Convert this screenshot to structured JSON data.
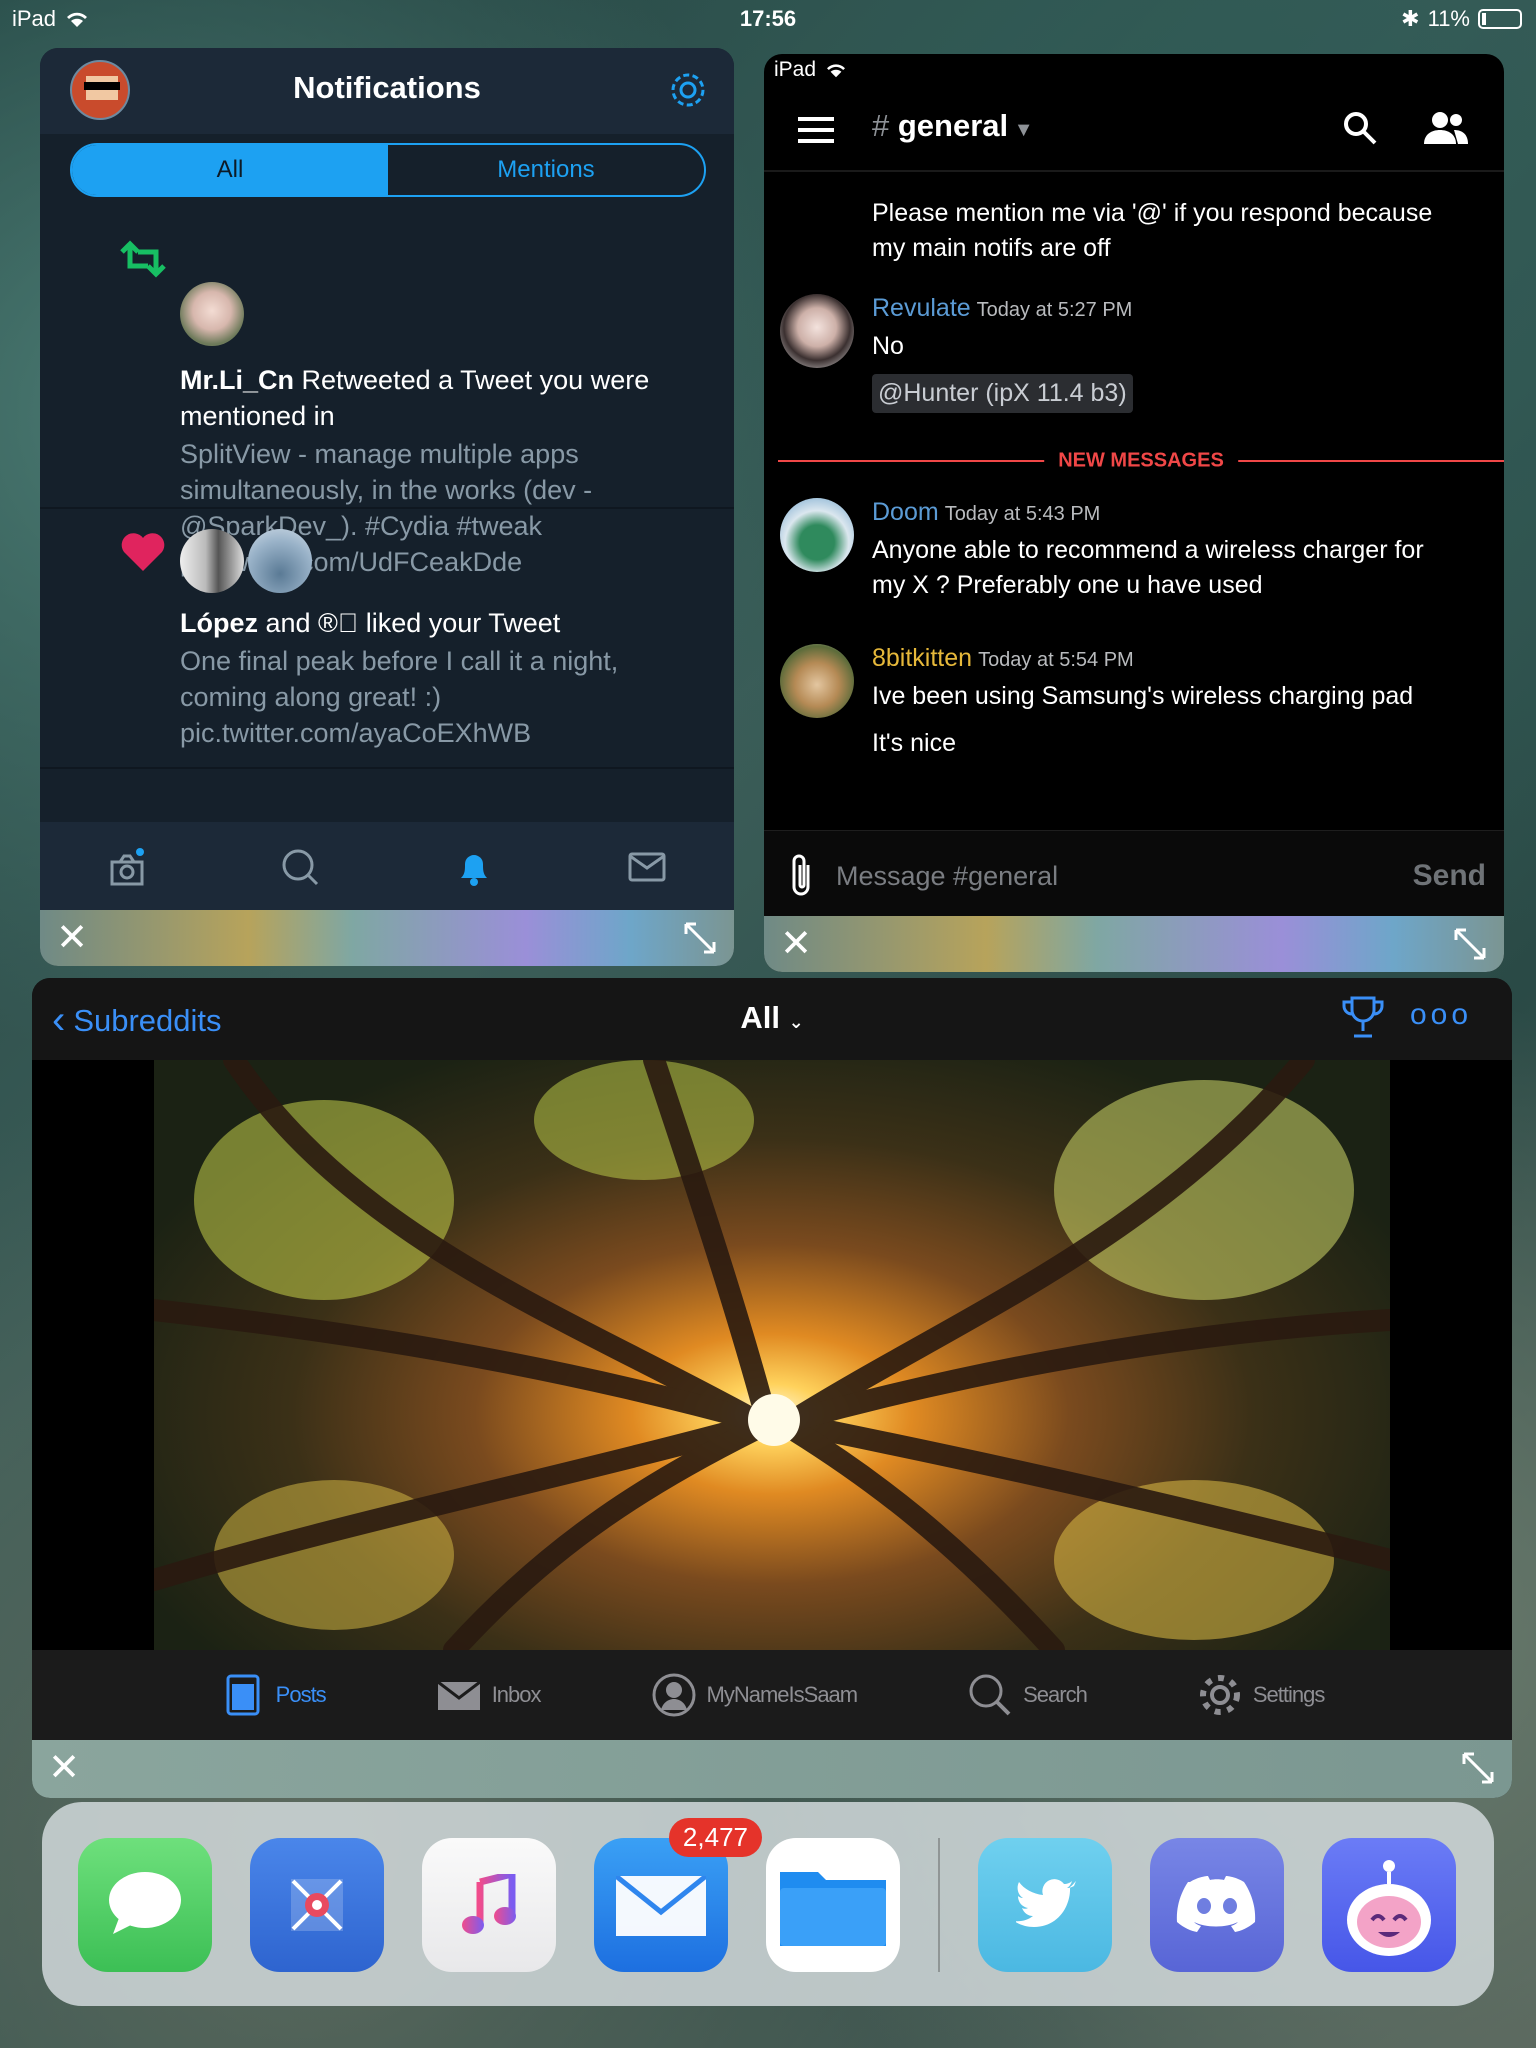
{
  "status_bar": {
    "device": "iPad",
    "time": "17:56",
    "battery": "11%"
  },
  "twitter": {
    "title": "Notifications",
    "segments": [
      "All",
      "Mentions"
    ],
    "notifications": [
      {
        "type": "retweet",
        "actor": "Mr.Li_Cn",
        "action": " Retweeted a Tweet you were mentioned in",
        "tweet": "SplitView - manage multiple apps simultaneously, in the works (dev - @SparkDev_). #Cydia #tweak pic.twitter.com/UdFCeakDde"
      },
      {
        "type": "like",
        "actor": "López",
        "action": "  and ® liked your Tweet",
        "tweet": "One final peak before I call it a night, coming along great! :) pic.twitter.com/ayaCoEXhWB"
      }
    ],
    "tabs": [
      "home-icon",
      "search-icon",
      "bell-icon",
      "mail-icon"
    ]
  },
  "discord": {
    "status_device": "iPad",
    "channel": "general",
    "messages": [
      {
        "author": null,
        "lines": [
          "Please mention me via '@' if you respond because",
          "my main notifs are off"
        ]
      },
      {
        "author": "Revulate",
        "author_color": "#5b9bd5",
        "time": "Today at 5:27 PM",
        "lines": [
          "No"
        ],
        "mention": "@Hunter (ipX 11.4 b3)"
      },
      {
        "author": "Doom",
        "author_color": "#5b9bd5",
        "time": "Today at 5:43 PM",
        "lines": [
          "Anyone able to recommend a wireless charger for",
          "my X ? Preferably one u have used"
        ]
      },
      {
        "author": "8bitkitten",
        "author_color": "#e6b83a",
        "time": "Today at 5:54 PM",
        "lines": [
          "Ive been using Samsung's wireless charging pad",
          "It's nice"
        ]
      }
    ],
    "divider": "NEW MESSAGES",
    "input_placeholder": "Message #general",
    "send_label": "Send"
  },
  "apollo": {
    "back_label": "Subreddits",
    "title": "All",
    "tabs": [
      {
        "label": "Posts",
        "icon": "posts-icon",
        "active": true
      },
      {
        "label": "Inbox",
        "icon": "inbox-icon",
        "active": false
      },
      {
        "label": "MyNameIsSaam",
        "icon": "profile-icon",
        "active": false
      },
      {
        "label": "Search",
        "icon": "search-icon",
        "active": false
      },
      {
        "label": "Settings",
        "icon": "gear-icon",
        "active": false
      }
    ]
  },
  "dock": {
    "apps": [
      {
        "name": "Messages",
        "color": "#5ccf6a"
      },
      {
        "name": "Focus app",
        "color": "#3f7be0"
      },
      {
        "name": "Music",
        "color": "#f2f2f2"
      },
      {
        "name": "Mail",
        "color": "#2f86ee",
        "badge": "2,477"
      },
      {
        "name": "Files",
        "color": "#ffffff"
      },
      {
        "name": "Twitter",
        "color": "#5ec6e8"
      },
      {
        "name": "Discord",
        "color": "#6f7ee0"
      },
      {
        "name": "Apollo",
        "color": "#5b6df0"
      }
    ]
  }
}
